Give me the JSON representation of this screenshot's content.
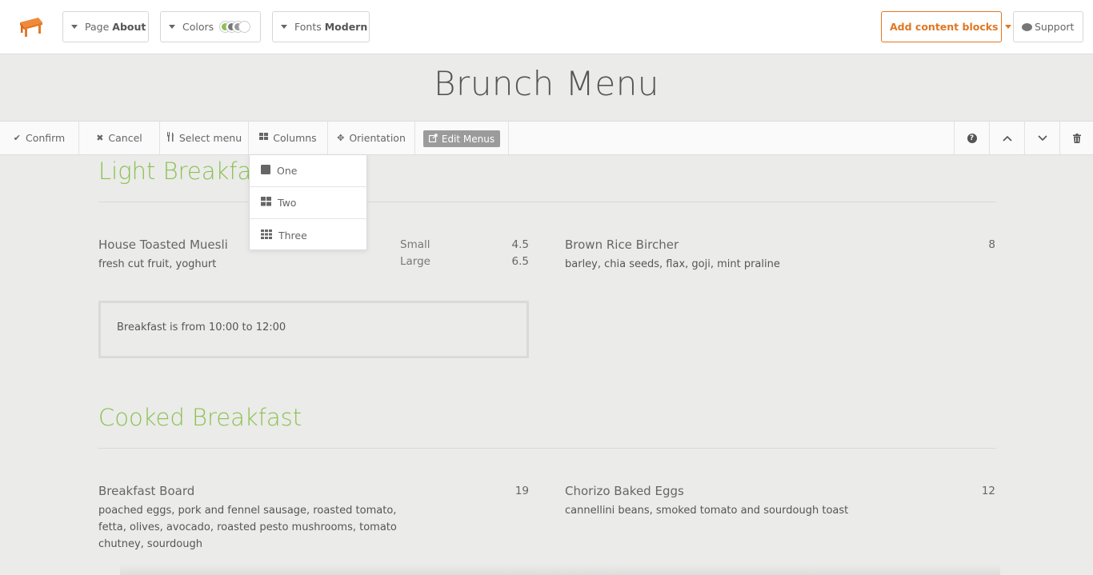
{
  "topbar": {
    "page_label": "Page",
    "page_value": "About",
    "colors_label": "Colors",
    "color_swatches": [
      "#8cc152",
      "#777777",
      "#999999",
      "#ffffff"
    ],
    "fonts_label": "Fonts",
    "fonts_value": "Modern",
    "add_blocks_label": "Add content blocks",
    "support_label": "Support",
    "accent_color": "#e07722"
  },
  "page_title": "Brunch Menu",
  "section_toolbar": {
    "confirm": "Confirm",
    "cancel": "Cancel",
    "select_menu": "Select menu",
    "columns": "Columns",
    "orientation": "Orientation",
    "edit_menus": "Edit Menus"
  },
  "columns_dropdown": {
    "options": [
      "One",
      "Two",
      "Three"
    ]
  },
  "menu": {
    "heading_color": "#8cc152",
    "sections": [
      {
        "title": "Light Breakfast",
        "items": [
          {
            "name": "House Toasted Muesli",
            "description": "fresh cut fruit, yoghurt",
            "sizes": [
              {
                "label": "Small",
                "price": "4.5"
              },
              {
                "label": "Large",
                "price": "6.5"
              }
            ]
          },
          {
            "name": "Brown Rice Bircher",
            "description": "barley, chia seeds, flax, goji, mint praline",
            "price": "8"
          }
        ],
        "note": "Breakfast is from 10:00 to 12:00"
      },
      {
        "title": "Cooked Breakfast",
        "items": [
          {
            "name": "Breakfast Board",
            "description_lines": [
              "poached eggs, pork and fennel sausage, roasted tomato,",
              "fetta, olives, avocado, roasted pesto mushrooms, tomato",
              "chutney, sourdough"
            ],
            "price": "19"
          },
          {
            "name": "Chorizo Baked Eggs",
            "description": "cannellini beans, smoked tomato and sourdough toast",
            "price": "12"
          }
        ]
      }
    ]
  }
}
